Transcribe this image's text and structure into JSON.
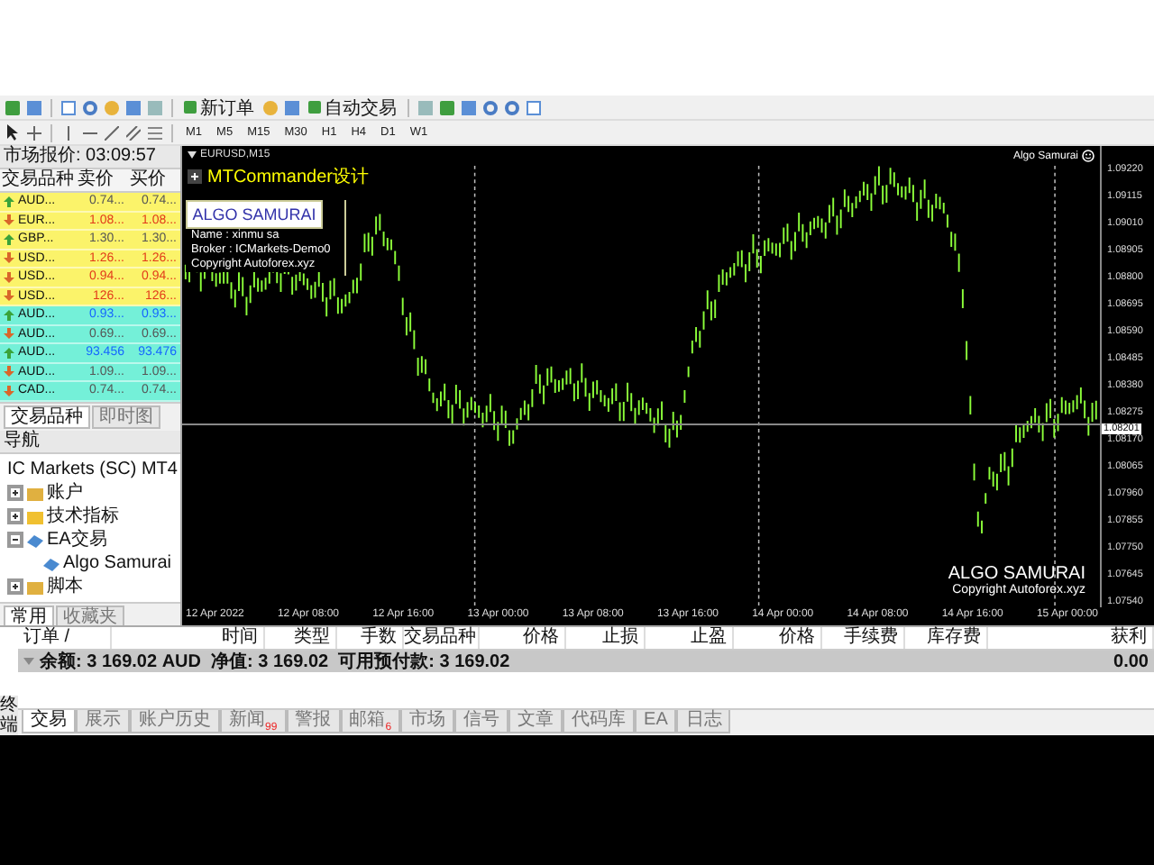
{
  "toolbar": {
    "new_order": "新订单",
    "auto_trading": "自动交易",
    "periods": [
      "M1",
      "M5",
      "M15",
      "M30",
      "H1",
      "H4",
      "D1",
      "W1"
    ]
  },
  "market_watch": {
    "title": "市场报价: 03:09:57",
    "columns": [
      "交易品种",
      "卖价",
      "买价"
    ],
    "rows": [
      {
        "symbol": "AUD...",
        "bid": "0.74...",
        "ask": "0.74...",
        "rising": true,
        "moved": false,
        "color": "#fbf36a"
      },
      {
        "symbol": "EUR...",
        "bid": "1.08...",
        "ask": "1.08...",
        "rising": false,
        "moved": true,
        "color": "#fbf36a"
      },
      {
        "symbol": "GBP...",
        "bid": "1.30...",
        "ask": "1.30...",
        "rising": true,
        "moved": false,
        "color": "#fbf36a"
      },
      {
        "symbol": "USD...",
        "bid": "1.26...",
        "ask": "1.26...",
        "rising": false,
        "moved": true,
        "color": "#fbf36a"
      },
      {
        "symbol": "USD...",
        "bid": "0.94...",
        "ask": "0.94...",
        "rising": false,
        "moved": true,
        "color": "#fbf36a"
      },
      {
        "symbol": "USD...",
        "bid": "126...",
        "ask": "126...",
        "rising": false,
        "moved": true,
        "color": "#fbf36a"
      },
      {
        "symbol": "AUD...",
        "bid": "0.93...",
        "ask": "0.93...",
        "rising": true,
        "moved": true,
        "color": "#74f0d8"
      },
      {
        "symbol": "AUD...",
        "bid": "0.69...",
        "ask": "0.69...",
        "rising": false,
        "moved": false,
        "color": "#74f0d8"
      },
      {
        "symbol": "AUD...",
        "bid": "93.456",
        "ask": "93.476",
        "rising": true,
        "moved": true,
        "color": "#74f0d8"
      },
      {
        "symbol": "AUD...",
        "bid": "1.09...",
        "ask": "1.09...",
        "rising": false,
        "moved": false,
        "color": "#74f0d8"
      },
      {
        "symbol": "CAD...",
        "bid": "0.74...",
        "ask": "0.74...",
        "rising": false,
        "moved": false,
        "color": "#74f0d8"
      }
    ],
    "tabs": [
      {
        "label": "交易品种",
        "selected": true
      },
      {
        "label": "即时图",
        "selected": false
      }
    ]
  },
  "navigator": {
    "title": "导航",
    "tree": [
      {
        "label": "IC Markets (SC) MT4",
        "children": [
          {
            "label": "账户",
            "kind": "accounts",
            "expanded": false
          },
          {
            "label": "技术指标",
            "kind": "indicators",
            "expanded": false
          },
          {
            "label": "EA交易",
            "kind": "experts",
            "expanded": true,
            "children": [
              {
                "label": "Algo Samurai",
                "kind": "expert"
              }
            ]
          },
          {
            "label": "脚本",
            "kind": "scripts",
            "expanded": false
          }
        ]
      }
    ],
    "tabs": [
      {
        "label": "常用",
        "selected": true
      },
      {
        "label": "收藏夹",
        "selected": false
      }
    ]
  },
  "chart": {
    "symbol": "EURUSD,M15",
    "commander": "MTCommander设计",
    "info_title": "ALGO SAMURAI",
    "info_lines": [
      "Name : xinmu sa",
      "Broker : ICMarkets-Demo0",
      "Copyright  Autoforex.xyz"
    ],
    "ea_label": "Algo Samurai",
    "footer_title": "ALGO SAMURAI",
    "footer_copyright": "Copyright  Autoforex.xyz",
    "price_labels": [
      "1.09220",
      "1.09115",
      "1.09010",
      "1.08905",
      "1.08800",
      "1.08695",
      "1.08590",
      "1.08485",
      "1.08380",
      "1.08275",
      "1.08170",
      "1.08065",
      "1.07960",
      "1.07855",
      "1.07750",
      "1.07645",
      "1.07540"
    ],
    "current_price": "1.08201",
    "time_labels": [
      "12 Apr 2022",
      "12 Apr 08:00",
      "12 Apr 16:00",
      "13 Apr 00:00",
      "13 Apr 08:00",
      "13 Apr 16:00",
      "14 Apr 00:00",
      "14 Apr 08:00",
      "14 Apr 16:00",
      "15 Apr 00:00"
    ]
  },
  "terminal": {
    "side_label": "终端",
    "columns": [
      "订单 /",
      "时间",
      "类型",
      "手数",
      "交易品种",
      "价格",
      "止损",
      "止盈",
      "价格",
      "手续费",
      "库存费",
      "获利"
    ],
    "balance": "余额: 3 169.02 AUD  净值: 3 169.02  可用预付款: 3 169.02",
    "profit": "0.00",
    "tabs": [
      {
        "label": "交易",
        "selected": true
      },
      {
        "label": "展示",
        "selected": false
      },
      {
        "label": "账户历史",
        "selected": false
      },
      {
        "label": "新闻",
        "selected": false,
        "badge": "99"
      },
      {
        "label": "警报",
        "selected": false
      },
      {
        "label": "邮箱",
        "selected": false,
        "badge": "6"
      },
      {
        "label": "市场",
        "selected": false
      },
      {
        "label": "信号",
        "selected": false
      },
      {
        "label": "文章",
        "selected": false
      },
      {
        "label": "代码库",
        "selected": false
      },
      {
        "label": "EA",
        "selected": false
      },
      {
        "label": "日志",
        "selected": false
      }
    ]
  }
}
